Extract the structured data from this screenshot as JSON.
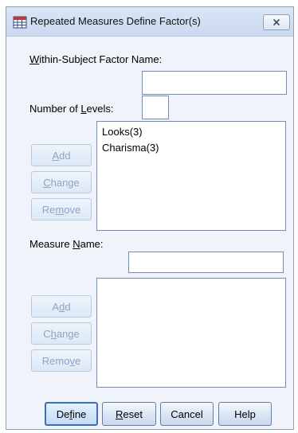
{
  "window": {
    "title": "Repeated Measures Define Factor(s)",
    "close_icon": "close-icon",
    "app_icon": "spss-table-icon"
  },
  "factor_section": {
    "name_label_prefix": "",
    "name_label_mnemonic": "W",
    "name_label_rest": "ithin-Subject Factor Name:",
    "name_value": "",
    "levels_label_prefix": "Number of ",
    "levels_label_mnemonic": "L",
    "levels_label_rest": "evels:",
    "levels_value": "",
    "list_items": [
      "Looks(3)",
      "Charisma(3)"
    ],
    "buttons": {
      "add": {
        "pre": "",
        "mn": "A",
        "post": "dd"
      },
      "change": {
        "pre": "",
        "mn": "C",
        "post": "hange"
      },
      "remove": {
        "pre": "Re",
        "mn": "m",
        "post": "ove"
      }
    }
  },
  "measure_section": {
    "label_prefix": "Measure ",
    "label_mnemonic": "N",
    "label_rest": "ame:",
    "name_value": "",
    "list_items": [],
    "buttons": {
      "add": {
        "pre": "A",
        "mn": "d",
        "post": "d"
      },
      "change": {
        "pre": "C",
        "mn": "h",
        "post": "ange"
      },
      "remove": {
        "pre": "Remo",
        "mn": "v",
        "post": "e"
      }
    }
  },
  "footer_buttons": {
    "define": {
      "pre": "De",
      "mn": "f",
      "post": "ine"
    },
    "reset": {
      "pre": "",
      "mn": "R",
      "post": "eset"
    },
    "cancel": {
      "pre": "Cancel",
      "mn": "",
      "post": ""
    },
    "help": {
      "pre": "Help",
      "mn": "",
      "post": ""
    }
  },
  "colors": {
    "accent": "#3c6fb5",
    "disabled_text": "#8ea4c2",
    "window_bg": "#f0f4fa"
  }
}
